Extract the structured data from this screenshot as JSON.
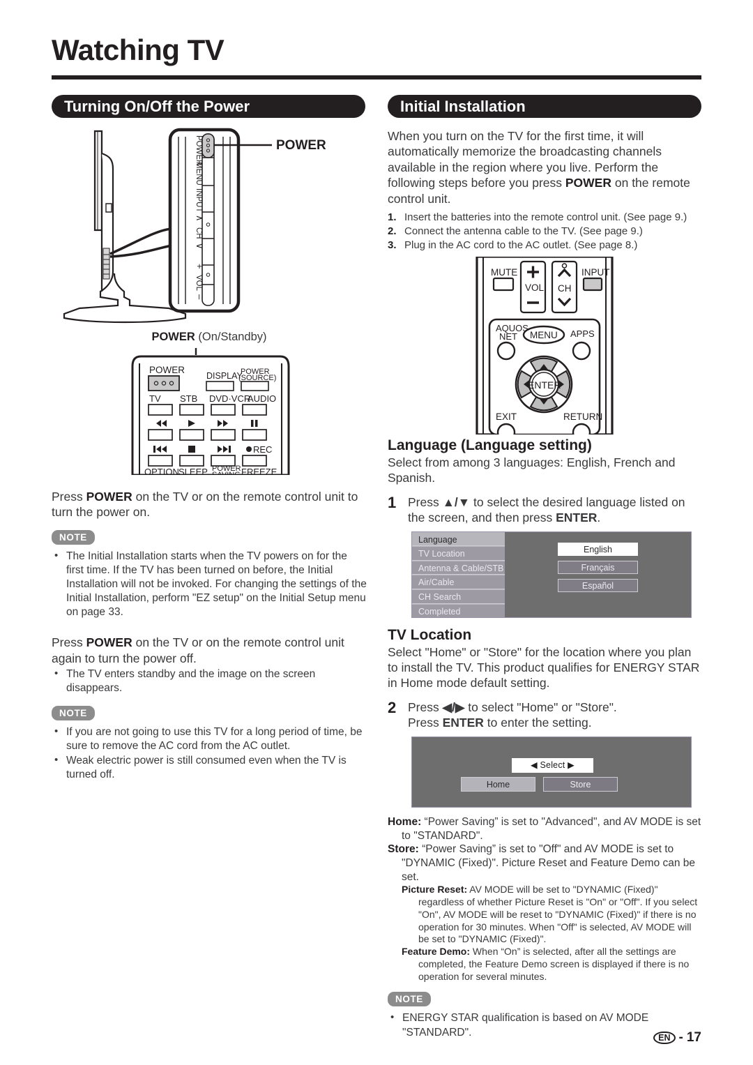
{
  "page": {
    "title": "Watching TV",
    "footer_locale": "EN",
    "footer_sep": "-",
    "footer_page": "17"
  },
  "left": {
    "section_title": "Turning On/Off the Power",
    "tv_figure": {
      "callout_label": "POWER",
      "panel_labels": [
        "POWER",
        "MENU",
        "INPUT",
        "CH",
        "VOL"
      ],
      "ch_up": "∧",
      "ch_down": "∨",
      "vol_plus": "+",
      "vol_minus": "–",
      "caption_bold": "POWER",
      "caption_rest": " (On/Standby)"
    },
    "remote": {
      "power_label": "POWER",
      "display_label": "DISPLAY",
      "power_source_label_1": "POWER",
      "power_source_label_2": "(SOURCE)",
      "row_devices": [
        "TV",
        "STB",
        "DVD·VCR",
        "AUDIO"
      ],
      "row_transport1": [
        "◀◀",
        "▶",
        "▶▶",
        "❙❙"
      ],
      "row_transport2": [
        "❙◀◀",
        "■",
        "▶▶❙",
        "●REC"
      ],
      "row_bottom": [
        "OPTION",
        "SLEEP",
        "POWER SAVING",
        "FREEZE"
      ],
      "power_saving_line1": "POWER",
      "power_saving_line2": "SAVING"
    },
    "power_on_text_pre": "Press ",
    "power_on_text_bold": "POWER",
    "power_on_text_post": " on the TV or on the remote control unit to turn the power on.",
    "note_label_1": "NOTE",
    "note_1_bullets": [
      "The Initial Installation starts when the TV powers on for the first time. If the TV has been turned on before, the Initial Installation will not be invoked. For changing the settings of the Initial Installation, perform \"EZ setup\" on the Initial Setup menu on page 33."
    ],
    "power_off_text_pre": "Press ",
    "power_off_text_bold": "POWER",
    "power_off_text_post": " on the TV or on the remote control unit again to turn the power off.",
    "power_off_bullets": [
      "The TV enters standby and the image on the screen disappears."
    ],
    "note_label_2": "NOTE",
    "note_2_bullets": [
      "If you are not going to use this TV for a long period of time, be sure to remove the AC cord from the AC outlet.",
      "Weak electric power is still consumed even when the TV is turned off."
    ]
  },
  "right": {
    "section_title": "Initial Installation",
    "intro_pre": "When you turn on the TV for the first time, it will automatically memorize the broadcasting channels available in the region where you live. Perform the following steps before you press ",
    "intro_bold": "POWER",
    "intro_post": " on the remote control unit.",
    "steps": [
      {
        "n": "1.",
        "text": "Insert the batteries into the remote control unit. (See page 9.)"
      },
      {
        "n": "2.",
        "text": "Connect the antenna cable to the TV. (See page 9.)"
      },
      {
        "n": "3.",
        "text": "Plug in the AC cord to the AC outlet. (See page 8.)"
      }
    ],
    "remote": {
      "mute": "MUTE",
      "vol": "VOL",
      "vol_plus": "+",
      "vol_minus": "−",
      "ch": "CH",
      "ch_up": "∧",
      "ch_down": "∨",
      "input": "INPUT",
      "aquos_1": "AQUOS",
      "aquos_2": "NET",
      "menu": "MENU",
      "apps": "APPS",
      "enter": "ENTER",
      "exit": "EXIT",
      "return": "RETURN",
      "arrow_up": "▲",
      "arrow_down": "▼",
      "arrow_left": "◀",
      "arrow_right": "▶"
    },
    "language": {
      "heading": "Language (Language setting)",
      "intro": "Select from among 3 languages: English, French and Spanish.",
      "step_number": "1",
      "step_pre": "Press ",
      "step_arrows": "▲/▼",
      "step_mid": " to select the desired language listed on the screen, and then press ",
      "step_bold": "ENTER",
      "step_post": ".",
      "osd": {
        "menu_items": [
          "Language",
          "TV Location",
          "Antenna & Cable/STB",
          "Air/Cable",
          "CH Search",
          "Completed"
        ],
        "selected_menu_index": 0,
        "options": [
          "English",
          "Français",
          "Español"
        ],
        "selected_option_index": 0
      }
    },
    "tv_location": {
      "heading": "TV Location",
      "intro": "Select \"Home\" or \"Store\" for the location where you plan to install the TV. This product qualifies for ENERGY STAR in Home mode default setting.",
      "step_number": "2",
      "step_pre": "Press ",
      "step_arrows": "◀/▶",
      "step_mid": " to select \"Home\" or \"Store\".",
      "step_line2_pre": "Press ",
      "step_line2_bold": "ENTER",
      "step_line2_post": " to enter the setting.",
      "osd": {
        "select_hint_left": "◀",
        "select_hint_text": "Select",
        "select_hint_right": "▶",
        "buttons": [
          "Home",
          "Store"
        ],
        "selected_button_index": 0
      },
      "definitions": [
        {
          "term": "Home:",
          "text": " “Power Saving” is set to \"Advanced\", and AV MODE is set to \"STANDARD\"."
        },
        {
          "term": "Store:",
          "text": " “Power Saving” is set to \"Off\" and AV MODE is set to \"DYNAMIC (Fixed)\". Picture Reset and Feature Demo can be set."
        }
      ],
      "sub_definitions": [
        {
          "term": "Picture Reset:",
          "text": " AV MODE will be set to \"DYNAMIC (Fixed)\" regardless of whether Picture Reset is \"On\" or \"Off\". If you select \"On\", AV MODE will be reset to \"DYNAMIC (Fixed)\" if there is no operation for 30 minutes. When \"Off\" is selected, AV MODE will be set to \"DYNAMIC (Fixed)\"."
        },
        {
          "term": "Feature Demo:",
          "text": " When “On” is selected, after all the settings are completed, the Feature Demo screen is displayed if there is no operation for several minutes."
        }
      ],
      "note_label": "NOTE",
      "note_bullets": [
        "ENERGY STAR qualification is based on AV MODE \"STANDARD\"."
      ]
    }
  },
  "colors": {
    "ink": "#231f20",
    "body": "#3a3a3c",
    "note_badge": "#8c8c8c",
    "osd_bg": "#6e6e6e",
    "osd_menu": "#9d9aa3",
    "osd_menu_selected": "#b8b6bd"
  }
}
